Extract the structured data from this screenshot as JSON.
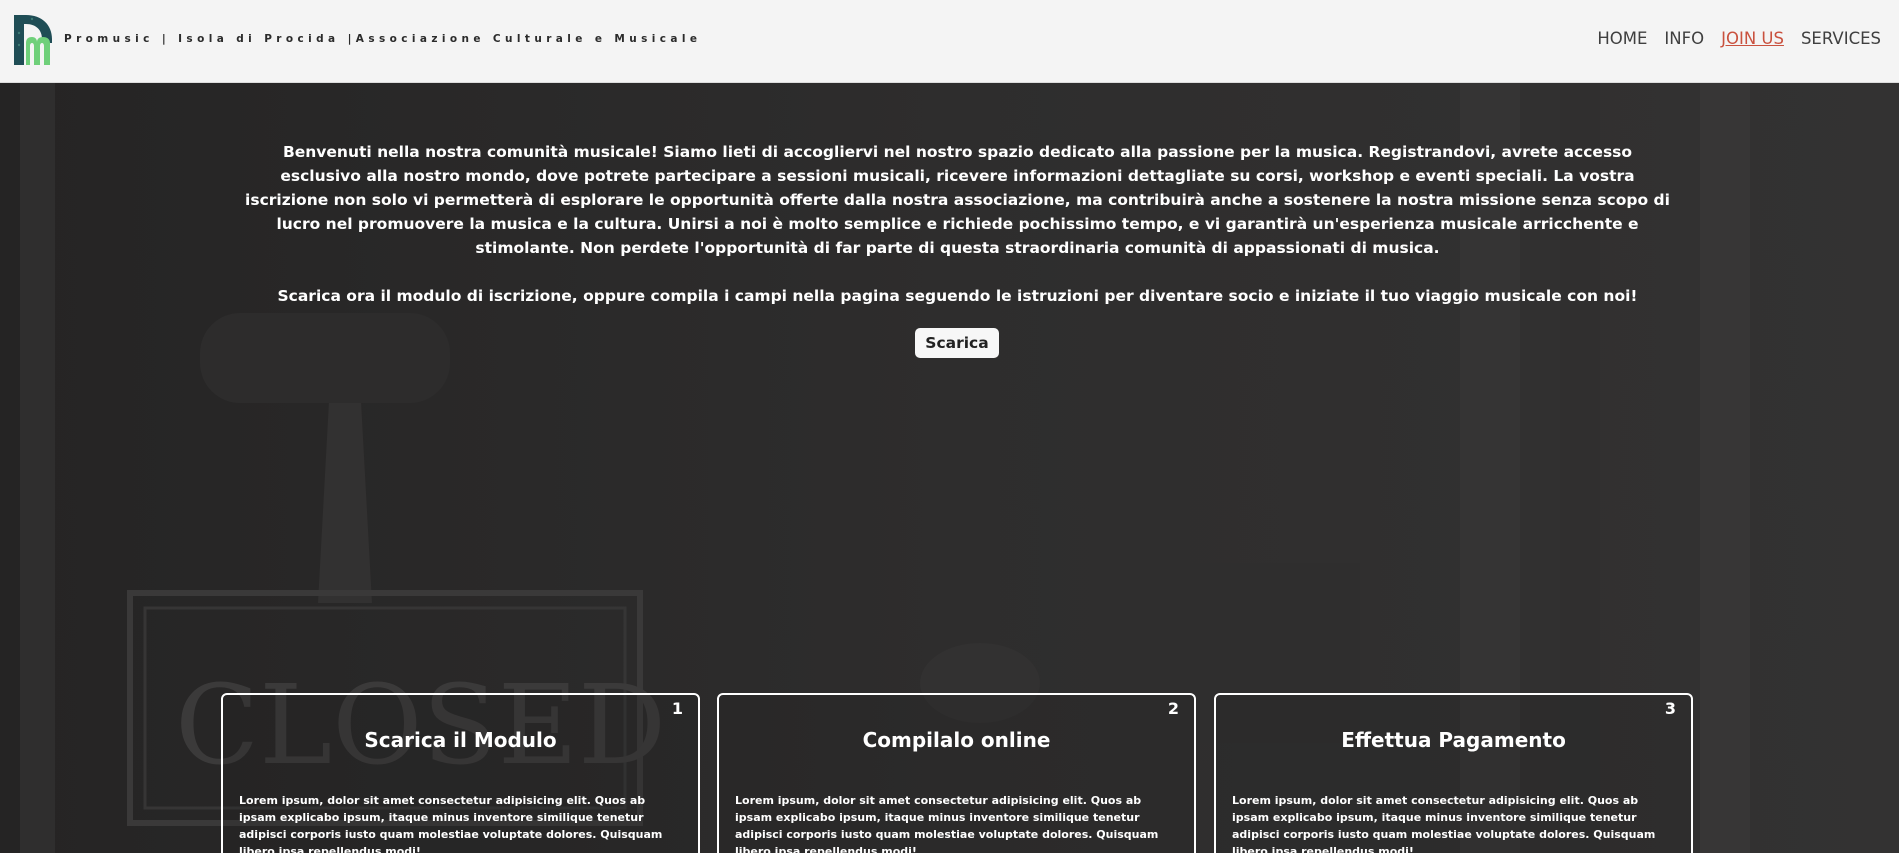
{
  "header": {
    "site_title": "Promusic | Isola di Procida |Associazione Culturale e Musicale",
    "nav": [
      {
        "label": "HOME",
        "active": false
      },
      {
        "label": "INFO",
        "active": false
      },
      {
        "label": "JOIN US",
        "active": true
      },
      {
        "label": "SERVICES",
        "active": false
      }
    ]
  },
  "hero": {
    "intro_text": "Benvenuti nella nostra comunità musicale! Siamo lieti di accogliervi nel nostro spazio dedicato alla passione per la musica. Registrandovi, avrete accesso esclusivo alla nostro mondo, dove potrete partecipare a sessioni musicali, ricevere informazioni dettagliate su corsi, workshop e eventi speciali. La vostra iscrizione non solo vi permetterà di esplorare le opportunità offerte dalla nostra associazione, ma contribuirà anche a sostenere la nostra missione senza scopo di lucro nel promuovere la musica e la cultura. Unirsi a noi è molto semplice e richiede pochissimo tempo, e vi garantirà un'esperienza musicale arricchente e stimolante. Non perdete l'opportunità di far parte di questa straordinaria comunità di appassionati di musica.",
    "cta_text": "Scarica ora il modulo di iscrizione, oppure compila i campi nella pagina seguendo le istruzioni per diventare socio e iniziate il tuo viaggio musicale con noi!",
    "download_label": "Scarica",
    "background_sign_text": "CLOSED"
  },
  "steps": [
    {
      "number": "1",
      "title": "Scarica il Modulo",
      "body": "Lorem ipsum, dolor sit amet consectetur adipisicing elit. Quos ab ipsam explicabo ipsum, itaque minus inventore similique tenetur adipisci corporis iusto quam molestiae voluptate dolores. Quisquam libero ipsa repellendus modi!"
    },
    {
      "number": "2",
      "title": "Compilalo online",
      "body": "Lorem ipsum, dolor sit amet consectetur adipisicing elit. Quos ab ipsam explicabo ipsum, itaque minus inventore similique tenetur adipisci corporis iusto quam molestiae voluptate dolores. Quisquam libero ipsa repellendus modi!"
    },
    {
      "number": "3",
      "title": "Effettua Pagamento",
      "body": "Lorem ipsum, dolor sit amet consectetur adipisicing elit. Quos ab ipsam explicabo ipsum, itaque minus inventore similique tenetur adipisci corporis iusto quam molestiae voluptate dolores. Quisquam libero ipsa repellendus modi!"
    }
  ],
  "colors": {
    "header_bg": "#f4f4f4",
    "nav_active": "#c9513e",
    "logo_dark": "#1f4d55",
    "logo_green": "#6fd07a"
  },
  "icons": {
    "logo": "promusic-logo-icon"
  }
}
